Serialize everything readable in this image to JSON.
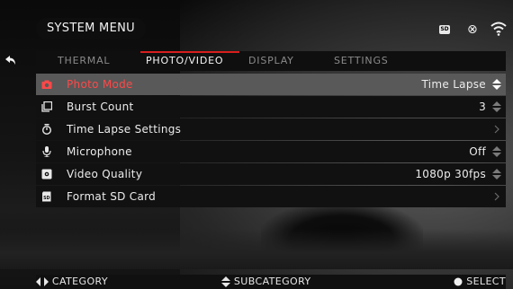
{
  "header": {
    "title": "SYSTEM MENU",
    "sd_badge": "SD"
  },
  "tabs": [
    {
      "label": "THERMAL"
    },
    {
      "label": "PHOTO/VIDEO"
    },
    {
      "label": "DISPLAY"
    },
    {
      "label": "SETTINGS"
    }
  ],
  "active_tab": "PHOTO/VIDEO",
  "menu": [
    {
      "label": "Photo Mode",
      "value": "Time Lapse",
      "control": "updown",
      "icon": "camera-icon",
      "selected": true
    },
    {
      "label": "Burst Count",
      "value": "3",
      "control": "updown",
      "icon": "burst-icon"
    },
    {
      "label": "Time Lapse Settings",
      "value": "",
      "control": "chevron",
      "icon": "stopwatch-icon"
    },
    {
      "label": "Microphone",
      "value": "Off",
      "control": "updown",
      "icon": "microphone-icon"
    },
    {
      "label": "Video Quality",
      "value": "1080p 30fps",
      "control": "updown",
      "icon": "video-quality-icon"
    },
    {
      "label": "Format SD Card",
      "value": "",
      "control": "chevron",
      "icon": "sd-card-icon"
    }
  ],
  "footer": {
    "category": "CATEGORY",
    "subcategory": "SUBCATEGORY",
    "select": "SELECT"
  },
  "colors": {
    "accent_red": "#d81e1e",
    "selected_row": "#595959",
    "selected_text": "#ff4848"
  }
}
